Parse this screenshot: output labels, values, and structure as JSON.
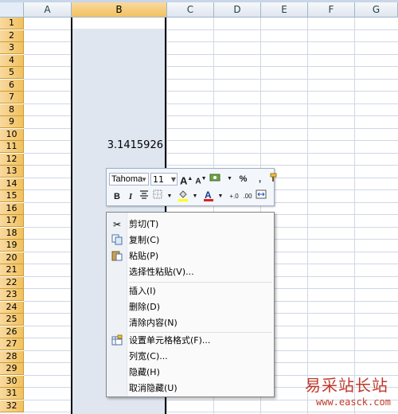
{
  "columns": [
    "A",
    "B",
    "C",
    "D",
    "E",
    "F",
    "G"
  ],
  "rows": [
    "1",
    "2",
    "3",
    "4",
    "5",
    "6",
    "7",
    "8",
    "9",
    "10",
    "11",
    "12",
    "13",
    "14",
    "15",
    "16",
    "17",
    "18",
    "19",
    "20",
    "21",
    "22",
    "23",
    "24",
    "25",
    "26",
    "27",
    "28",
    "29",
    "30",
    "31",
    "32"
  ],
  "cell_b11": "3.1415926",
  "mini_toolbar": {
    "font": "Tahoma",
    "size": "11",
    "grow_font": "A",
    "shrink_font": "A",
    "percent": "%",
    "comma": ",",
    "bold": "B",
    "italic": "I",
    "increase_decimal": "+.0",
    "decrease_decimal": ".00"
  },
  "context_menu": [
    {
      "label": "剪切(T)",
      "icon": "scissors-icon"
    },
    {
      "label": "复制(C)",
      "icon": "copy-icon"
    },
    {
      "label": "粘贴(P)",
      "icon": "paste-icon"
    },
    {
      "label": "选择性粘贴(V)...",
      "icon": ""
    },
    {
      "label": "插入(I)",
      "icon": ""
    },
    {
      "label": "删除(D)",
      "icon": ""
    },
    {
      "label": "清除内容(N)",
      "icon": ""
    },
    {
      "label": "设置单元格格式(F)...",
      "icon": "format-cells-icon"
    },
    {
      "label": "列宽(C)...",
      "icon": ""
    },
    {
      "label": "隐藏(H)",
      "icon": ""
    },
    {
      "label": "取消隐藏(U)",
      "icon": ""
    }
  ],
  "watermark": {
    "title": "易采站长站",
    "url": "www.easck.com"
  },
  "colors": {
    "selection": "#dfe6f0",
    "header_selected": "#f1c15f",
    "font_color_accent": "#e02020",
    "fill_accent": "#ffff00"
  }
}
